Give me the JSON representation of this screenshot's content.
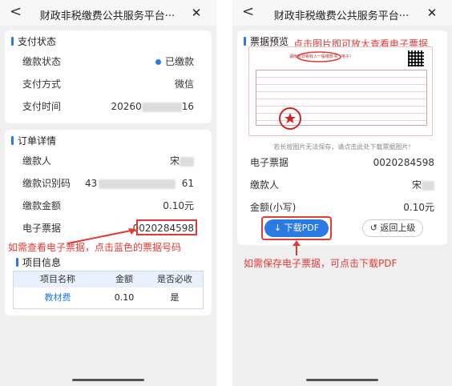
{
  "left": {
    "topbar": {
      "back": "<",
      "title": "财政非税缴费公共服务平台···",
      "close": "✕"
    },
    "payment_status": {
      "heading": "支付状态",
      "rows": [
        {
          "label": "缴款状态",
          "value": "已缴款"
        },
        {
          "label": "支付方式",
          "value": "微信"
        },
        {
          "label": "支付时间",
          "value_prefix": "20260",
          "value_suffix": "16"
        }
      ]
    },
    "order_details": {
      "heading": "订单详情",
      "rows": [
        {
          "label": "缴款人",
          "value_prefix": "宋"
        },
        {
          "label": "缴款识别码",
          "value_prefix": "43",
          "value_suffix": "61"
        },
        {
          "label": "缴款金额",
          "value": "0.10元"
        },
        {
          "label": "电子票据",
          "value": "0020284598"
        }
      ]
    },
    "annotation": "如需查看电子票据，点击蓝色的票据号码",
    "project_info": {
      "heading": "项目信息",
      "columns": [
        "项目名称",
        "金额",
        "是否必收"
      ],
      "rows": [
        {
          "name": "教材费",
          "amount": "0.10",
          "required": "是"
        }
      ]
    }
  },
  "right": {
    "topbar": {
      "back": "<",
      "title": "财政非税缴费公共服务平台···",
      "close": "✕"
    },
    "preview": {
      "heading": "票据预览",
      "annotation_top": "点击图片即可放大查看电子票据",
      "invoice_title": "湖南省非税收入一般缴款书（电子）",
      "hint": "若长按图片无法保存，请点击此处下载票据图片!"
    },
    "rows": [
      {
        "label": "电子票据",
        "value": "0020284598"
      },
      {
        "label": "缴款人",
        "value_prefix": "宋"
      },
      {
        "label": "金额(小写)",
        "value": "0.10元"
      }
    ],
    "download_label": "下载PDF",
    "return_label": "返回上级",
    "annotation_bottom": "如需保存电子票据，可点击下载PDF",
    "colors": {
      "accent": "#2a7ae2",
      "annotation": "#e53935"
    }
  }
}
